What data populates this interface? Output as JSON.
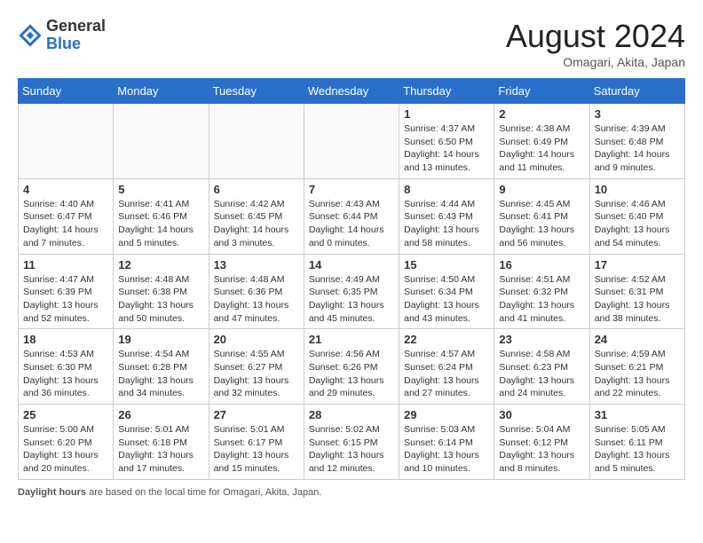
{
  "header": {
    "logo": {
      "line1": "General",
      "line2": "Blue"
    },
    "title": "August 2024",
    "subtitle": "Omagari, Akita, Japan"
  },
  "days_of_week": [
    "Sunday",
    "Monday",
    "Tuesday",
    "Wednesday",
    "Thursday",
    "Friday",
    "Saturday"
  ],
  "weeks": [
    [
      {
        "day": "",
        "info": ""
      },
      {
        "day": "",
        "info": ""
      },
      {
        "day": "",
        "info": ""
      },
      {
        "day": "",
        "info": ""
      },
      {
        "day": "1",
        "info": "Sunrise: 4:37 AM\nSunset: 6:50 PM\nDaylight: 14 hours\nand 13 minutes."
      },
      {
        "day": "2",
        "info": "Sunrise: 4:38 AM\nSunset: 6:49 PM\nDaylight: 14 hours\nand 11 minutes."
      },
      {
        "day": "3",
        "info": "Sunrise: 4:39 AM\nSunset: 6:48 PM\nDaylight: 14 hours\nand 9 minutes."
      }
    ],
    [
      {
        "day": "4",
        "info": "Sunrise: 4:40 AM\nSunset: 6:47 PM\nDaylight: 14 hours\nand 7 minutes."
      },
      {
        "day": "5",
        "info": "Sunrise: 4:41 AM\nSunset: 6:46 PM\nDaylight: 14 hours\nand 5 minutes."
      },
      {
        "day": "6",
        "info": "Sunrise: 4:42 AM\nSunset: 6:45 PM\nDaylight: 14 hours\nand 3 minutes."
      },
      {
        "day": "7",
        "info": "Sunrise: 4:43 AM\nSunset: 6:44 PM\nDaylight: 14 hours\nand 0 minutes."
      },
      {
        "day": "8",
        "info": "Sunrise: 4:44 AM\nSunset: 6:43 PM\nDaylight: 13 hours\nand 58 minutes."
      },
      {
        "day": "9",
        "info": "Sunrise: 4:45 AM\nSunset: 6:41 PM\nDaylight: 13 hours\nand 56 minutes."
      },
      {
        "day": "10",
        "info": "Sunrise: 4:46 AM\nSunset: 6:40 PM\nDaylight: 13 hours\nand 54 minutes."
      }
    ],
    [
      {
        "day": "11",
        "info": "Sunrise: 4:47 AM\nSunset: 6:39 PM\nDaylight: 13 hours\nand 52 minutes."
      },
      {
        "day": "12",
        "info": "Sunrise: 4:48 AM\nSunset: 6:38 PM\nDaylight: 13 hours\nand 50 minutes."
      },
      {
        "day": "13",
        "info": "Sunrise: 4:48 AM\nSunset: 6:36 PM\nDaylight: 13 hours\nand 47 minutes."
      },
      {
        "day": "14",
        "info": "Sunrise: 4:49 AM\nSunset: 6:35 PM\nDaylight: 13 hours\nand 45 minutes."
      },
      {
        "day": "15",
        "info": "Sunrise: 4:50 AM\nSunset: 6:34 PM\nDaylight: 13 hours\nand 43 minutes."
      },
      {
        "day": "16",
        "info": "Sunrise: 4:51 AM\nSunset: 6:32 PM\nDaylight: 13 hours\nand 41 minutes."
      },
      {
        "day": "17",
        "info": "Sunrise: 4:52 AM\nSunset: 6:31 PM\nDaylight: 13 hours\nand 38 minutes."
      }
    ],
    [
      {
        "day": "18",
        "info": "Sunrise: 4:53 AM\nSunset: 6:30 PM\nDaylight: 13 hours\nand 36 minutes."
      },
      {
        "day": "19",
        "info": "Sunrise: 4:54 AM\nSunset: 6:28 PM\nDaylight: 13 hours\nand 34 minutes."
      },
      {
        "day": "20",
        "info": "Sunrise: 4:55 AM\nSunset: 6:27 PM\nDaylight: 13 hours\nand 32 minutes."
      },
      {
        "day": "21",
        "info": "Sunrise: 4:56 AM\nSunset: 6:26 PM\nDaylight: 13 hours\nand 29 minutes."
      },
      {
        "day": "22",
        "info": "Sunrise: 4:57 AM\nSunset: 6:24 PM\nDaylight: 13 hours\nand 27 minutes."
      },
      {
        "day": "23",
        "info": "Sunrise: 4:58 AM\nSunset: 6:23 PM\nDaylight: 13 hours\nand 24 minutes."
      },
      {
        "day": "24",
        "info": "Sunrise: 4:59 AM\nSunset: 6:21 PM\nDaylight: 13 hours\nand 22 minutes."
      }
    ],
    [
      {
        "day": "25",
        "info": "Sunrise: 5:00 AM\nSunset: 6:20 PM\nDaylight: 13 hours\nand 20 minutes."
      },
      {
        "day": "26",
        "info": "Sunrise: 5:01 AM\nSunset: 6:18 PM\nDaylight: 13 hours\nand 17 minutes."
      },
      {
        "day": "27",
        "info": "Sunrise: 5:01 AM\nSunset: 6:17 PM\nDaylight: 13 hours\nand 15 minutes."
      },
      {
        "day": "28",
        "info": "Sunrise: 5:02 AM\nSunset: 6:15 PM\nDaylight: 13 hours\nand 12 minutes."
      },
      {
        "day": "29",
        "info": "Sunrise: 5:03 AM\nSunset: 6:14 PM\nDaylight: 13 hours\nand 10 minutes."
      },
      {
        "day": "30",
        "info": "Sunrise: 5:04 AM\nSunset: 6:12 PM\nDaylight: 13 hours\nand 8 minutes."
      },
      {
        "day": "31",
        "info": "Sunrise: 5:05 AM\nSunset: 6:11 PM\nDaylight: 13 hours\nand 5 minutes."
      }
    ]
  ],
  "footer": {
    "label": "Daylight hours",
    "description": " are based on the local time for Omagari, Akita, Japan."
  }
}
